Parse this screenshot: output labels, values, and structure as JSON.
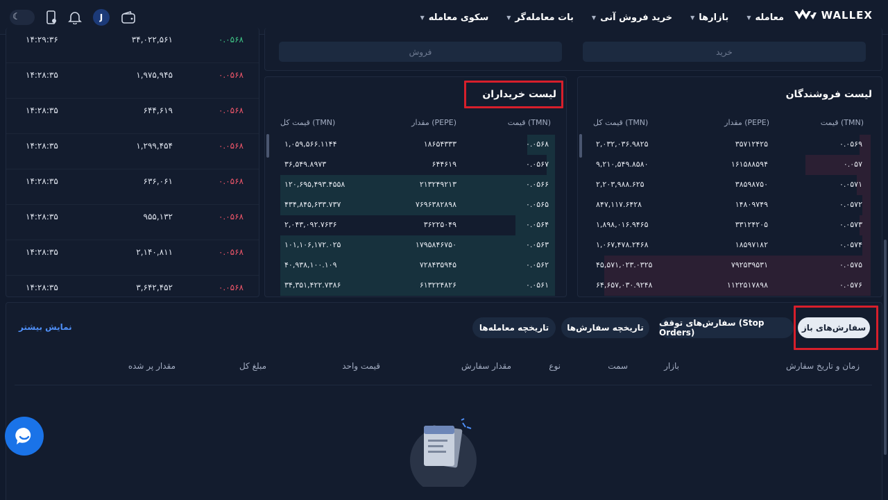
{
  "header": {
    "logo_text": "WALLEX",
    "nav": [
      "معامله",
      "بازارها",
      "خرید فروش آنی",
      "بات معامله‌گر",
      "سکوی معامله"
    ],
    "avatar_letter": "J"
  },
  "trades": [
    {
      "time": "۱۴:۲۹:۳۶",
      "amount": "۳۴,۰۲۲,۵۶۱",
      "price": "۰.۰۵۶۸",
      "side": "buy"
    },
    {
      "time": "۱۴:۲۸:۳۵",
      "amount": "۱,۹۷۵,۹۴۵",
      "price": "۰.۰۵۶۸",
      "side": "sell"
    },
    {
      "time": "۱۴:۲۸:۳۵",
      "amount": "۶۴۴,۶۱۹",
      "price": "۰.۰۵۶۸",
      "side": "sell"
    },
    {
      "time": "۱۴:۲۸:۳۵",
      "amount": "۱,۲۹۹,۴۵۴",
      "price": "۰.۰۵۶۸",
      "side": "sell"
    },
    {
      "time": "۱۴:۲۸:۳۵",
      "amount": "۶۳۶,۰۶۱",
      "price": "۰.۰۵۶۸",
      "side": "sell"
    },
    {
      "time": "۱۴:۲۸:۳۵",
      "amount": "۹۵۵,۱۳۲",
      "price": "۰.۰۵۶۸",
      "side": "sell"
    },
    {
      "time": "۱۴:۲۸:۳۵",
      "amount": "۲,۱۴۰,۸۱۱",
      "price": "۰.۰۵۶۸",
      "side": "sell"
    },
    {
      "time": "۱۴:۲۸:۳۵",
      "amount": "۳,۶۴۲,۴۵۲",
      "price": "۰.۰۵۶۸",
      "side": "sell"
    }
  ],
  "actions": {
    "buy": "خرید",
    "sell": "فروش"
  },
  "sellers": {
    "title": "لیست فروشندگان",
    "headers": {
      "price": "قیمت (TMN)",
      "amount": "مقدار (PEPE)",
      "total": "قیمت کل (TMN)"
    },
    "rows": [
      {
        "price": "۰.۰۵۶۹",
        "amount": "۳۵۷۱۲۴۲۵",
        "total": "۲,۰۳۲,۰۳۶.۹۸۲۵",
        "depth": 0.04
      },
      {
        "price": "۰.۰۵۷",
        "amount": "۱۶۱۵۸۸۵۹۴",
        "total": "۹,۲۱۰,۵۴۹.۸۵۸۰",
        "depth": 0.23
      },
      {
        "price": "۰.۰۵۷۱",
        "amount": "۳۸۵۹۸۷۵۰",
        "total": "۲,۲۰۳,۹۸۸.۶۲۵",
        "depth": 0.05
      },
      {
        "price": "۰.۰۵۷۲",
        "amount": "۱۴۸۰۹۷۴۹",
        "total": "۸۴۷,۱۱۷.۶۴۲۸",
        "depth": 0.03
      },
      {
        "price": "۰.۰۵۷۳",
        "amount": "۳۳۱۲۴۲۰۵",
        "total": "۱,۸۹۸,۰۱۶.۹۴۶۵",
        "depth": 0.04
      },
      {
        "price": "۰.۰۵۷۴",
        "amount": "۱۸۵۹۷۱۸۲",
        "total": "۱,۰۶۷,۴۷۸.۲۴۶۸",
        "depth": 0.03
      },
      {
        "price": "۰.۰۵۷۵",
        "amount": "۷۹۲۵۳۹۵۳۱",
        "total": "۴۵,۵۷۱,۰۲۳.۰۳۲۵",
        "depth": 0.94
      },
      {
        "price": "۰.۰۵۷۶",
        "amount": "۱۱۲۲۵۱۷۸۹۸",
        "total": "۶۴,۶۵۷,۰۳۰.۹۲۴۸",
        "depth": 0.94
      }
    ]
  },
  "buyers": {
    "title": "لیست خریداران",
    "headers": {
      "price": "قیمت (TMN)",
      "amount": "مقدار (PEPE)",
      "total": "قیمت کل (TMN)"
    },
    "rows": [
      {
        "price": "۰.۰۵۶۸",
        "amount": "۱۸۶۵۴۳۳۳",
        "total": "۱,۰۵۹,۵۶۶.۱۱۴۴",
        "depth": 0.1
      },
      {
        "price": "۰.۰۵۶۷",
        "amount": "۶۴۴۶۱۹",
        "total": "۳۶,۵۴۹.۸۹۷۳",
        "depth": 0.03
      },
      {
        "price": "۰.۰۵۶۶",
        "amount": "۲۱۳۲۴۹۲۱۳",
        "total": "۱۲۰,۶۹۵,۴۹۳.۴۵۵۸",
        "depth": 0.98
      },
      {
        "price": "۰.۰۵۶۵",
        "amount": "۷۶۹۶۳۸۲۸۹۸",
        "total": "۴۳۴,۸۴۵,۶۳۳.۷۳۷",
        "depth": 0.98
      },
      {
        "price": "۰.۰۵۶۴",
        "amount": "۳۶۲۲۵۰۴۹",
        "total": "۲,۰۴۳,۰۹۲.۷۶۳۶",
        "depth": 0.14
      },
      {
        "price": "۰.۰۵۶۳",
        "amount": "۱۷۹۵۸۴۶۷۵۰",
        "total": "۱۰۱,۱۰۶,۱۷۲.۰۲۵",
        "depth": 0.98
      },
      {
        "price": "۰.۰۵۶۲",
        "amount": "۷۲۸۴۳۵۹۴۵",
        "total": "۴۰,۹۳۸,۱۰۰.۱۰۹",
        "depth": 0.98
      },
      {
        "price": "۰.۰۵۶۱",
        "amount": "۶۱۳۲۲۴۸۲۶",
        "total": "۳۴,۳۵۱,۴۲۲.۷۳۸۶",
        "depth": 0.98
      }
    ]
  },
  "orders": {
    "tabs": [
      "سفارش‌های باز",
      "سفارش‌های توقف (Stop Orders)",
      "تاریخچه سفارش‌ها",
      "تاریخچه معامله‌ها"
    ],
    "show_more": "نمایش بیشتر",
    "columns": [
      "زمان و تاریخ سفارش",
      "بازار",
      "سمت",
      "نوع",
      "مقدار سفارش",
      "قیمت واحد",
      "مبلغ کل",
      "مقدار پر شده"
    ]
  },
  "colors": {
    "buy": "#3fc687",
    "sell": "#f0566a",
    "highlight": "#d71f2b"
  }
}
